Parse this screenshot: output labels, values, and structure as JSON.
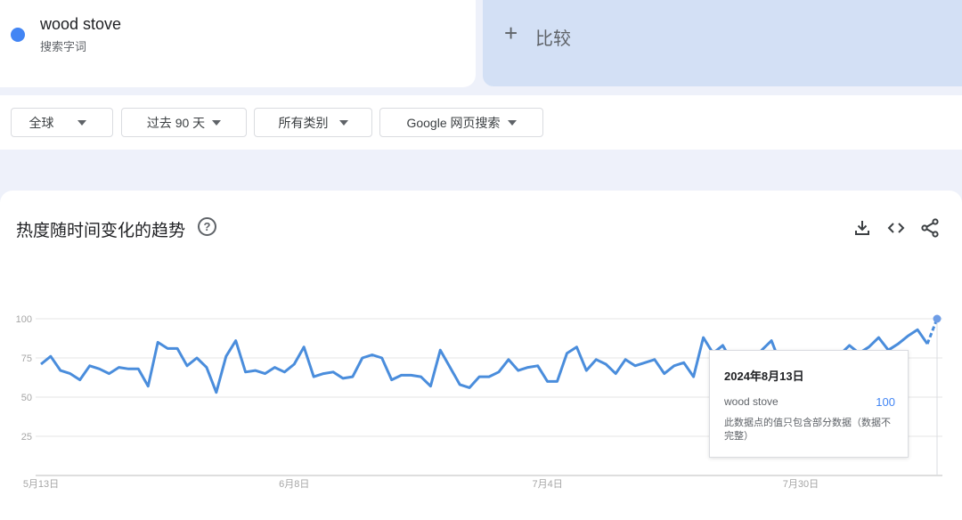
{
  "term": {
    "name": "wood stove",
    "type": "搜索字词",
    "color": "#4285f4"
  },
  "compare": {
    "label": "比较",
    "icon": "plus-icon"
  },
  "filters": [
    {
      "label": "全球"
    },
    {
      "label": "过去 90 天"
    },
    {
      "label": "所有类别"
    },
    {
      "label": "Google 网页搜索"
    }
  ],
  "chart_section": {
    "title": "热度随时间变化的趋势",
    "help_icon": "question-mark-icon",
    "help_glyph": "?",
    "tools": [
      "download-icon",
      "embed-code-icon",
      "share-icon"
    ]
  },
  "tooltip": {
    "date": "2024年8月13日",
    "series": "wood stove",
    "value": "100",
    "note": "此数据点的值只包含部分数据（数据不完整）"
  },
  "chart_data": {
    "type": "line",
    "title": "",
    "xlabel": "",
    "ylabel": "",
    "ylim": [
      0,
      100
    ],
    "yticks": [
      25,
      50,
      75,
      100
    ],
    "x_ticks": [
      {
        "label": "5月13日",
        "index": 0
      },
      {
        "label": "6月8日",
        "index": 26
      },
      {
        "label": "7月4日",
        "index": 52
      },
      {
        "label": "7月30日",
        "index": 78
      }
    ],
    "grid": true,
    "series": [
      {
        "name": "wood stove",
        "color": "#4a8ddc",
        "values": [
          71,
          76,
          67,
          65,
          61,
          70,
          68,
          65,
          69,
          68,
          68,
          57,
          85,
          81,
          81,
          70,
          75,
          69,
          53,
          76,
          86,
          66,
          67,
          65,
          69,
          66,
          71,
          82,
          63,
          65,
          66,
          62,
          63,
          75,
          77,
          75,
          61,
          64,
          64,
          63,
          57,
          80,
          69,
          58,
          56,
          63,
          63,
          66,
          74,
          67,
          69,
          70,
          60,
          60,
          78,
          82,
          67,
          74,
          71,
          65,
          74,
          70,
          72,
          74,
          65,
          70,
          72,
          63,
          88,
          78,
          83,
          72,
          75,
          70,
          80,
          86,
          70,
          73,
          70,
          68,
          72,
          68,
          77,
          83,
          78,
          82,
          88,
          80,
          84,
          89,
          93,
          84,
          100
        ]
      }
    ],
    "partial_from_index": 92
  }
}
